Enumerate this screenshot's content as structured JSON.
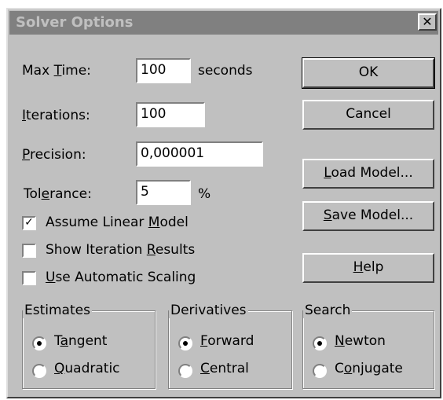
{
  "window": {
    "title": "Solver Options",
    "close_glyph": "✕"
  },
  "fields": {
    "max_time": {
      "label": "Max Time:",
      "value": "100",
      "unit": "seconds"
    },
    "iterations": {
      "label": "Iterations:",
      "value": "100"
    },
    "precision": {
      "label": "Precision:",
      "value": "0,000001"
    },
    "tolerance": {
      "label": "Tolerance:",
      "value": "5",
      "unit": "%"
    }
  },
  "checkboxes": {
    "assume_linear": {
      "label": "Assume Linear Model",
      "checked": true
    },
    "show_iteration": {
      "label": "Show Iteration Results",
      "checked": false
    },
    "automatic_scaling": {
      "label": "Use Automatic Scaling",
      "checked": false
    }
  },
  "buttons": {
    "ok": "OK",
    "cancel": "Cancel",
    "load_model": "Load Model...",
    "save_model": "Save Model...",
    "help": "Help"
  },
  "groups": {
    "estimates": {
      "title": "Estimates",
      "options": [
        "Tangent",
        "Quadratic"
      ],
      "selected": "Tangent"
    },
    "derivatives": {
      "title": "Derivatives",
      "options": [
        "Forward",
        "Central"
      ],
      "selected": "Forward"
    },
    "search": {
      "title": "Search",
      "options": [
        "Newton",
        "Conjugate"
      ],
      "selected": "Newton"
    }
  },
  "colors": {
    "face": "#c0c0c0",
    "titlebar": "#808080",
    "title_text": "#c0c0c0"
  }
}
